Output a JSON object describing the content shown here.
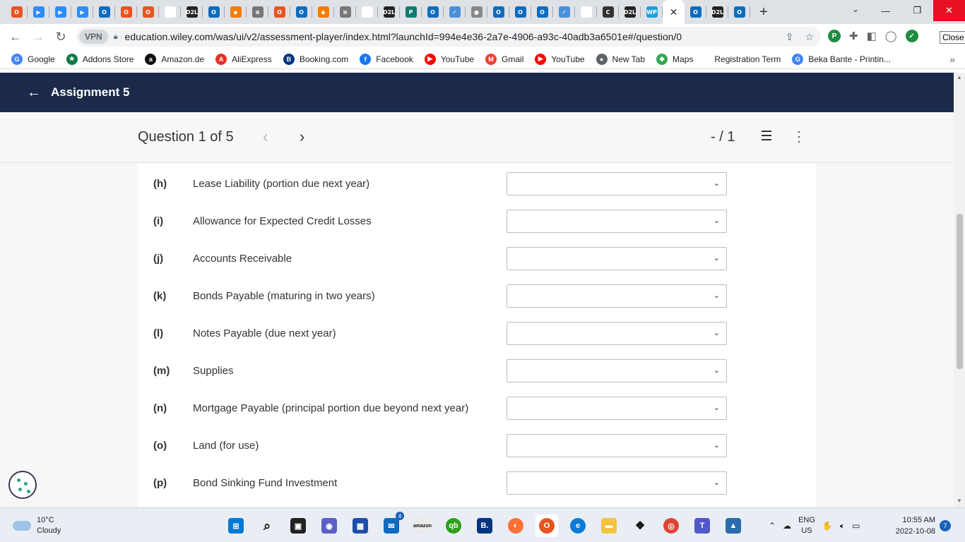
{
  "browser": {
    "tabs": [
      {
        "icon": "ubuntu-icon",
        "color": "#e95420",
        "glyph": "O"
      },
      {
        "icon": "zoom-icon",
        "color": "#2d8cff",
        "glyph": "▶"
      },
      {
        "icon": "zoom-icon",
        "color": "#2d8cff",
        "glyph": "▶"
      },
      {
        "icon": "zoom-icon",
        "color": "#2d8cff",
        "glyph": "▶"
      },
      {
        "icon": "outlook-icon",
        "color": "#0f6cbd",
        "glyph": "O"
      },
      {
        "icon": "ubuntu-icon",
        "color": "#e95420",
        "glyph": "O"
      },
      {
        "icon": "ubuntu-icon",
        "color": "#e95420",
        "glyph": "O"
      },
      {
        "icon": "blank-icon",
        "color": "#ffffff",
        "glyph": ""
      },
      {
        "icon": "d2l-icon",
        "color": "#222222",
        "glyph": "D2L"
      },
      {
        "icon": "outlook-icon",
        "color": "#0f6cbd",
        "glyph": "O"
      },
      {
        "icon": "drop-icon",
        "color": "#f57c00",
        "glyph": "◆"
      },
      {
        "icon": "doc-icon",
        "color": "#777777",
        "glyph": "≡"
      },
      {
        "icon": "ubuntu-icon",
        "color": "#e95420",
        "glyph": "O"
      },
      {
        "icon": "outlook-icon",
        "color": "#0f6cbd",
        "glyph": "O"
      },
      {
        "icon": "drop-icon",
        "color": "#f57c00",
        "glyph": "◆"
      },
      {
        "icon": "doc-icon",
        "color": "#777777",
        "glyph": "≡"
      },
      {
        "icon": "blank-icon",
        "color": "#ffffff",
        "glyph": ""
      },
      {
        "icon": "d2l-icon",
        "color": "#222222",
        "glyph": "D2L"
      },
      {
        "icon": "pearson-icon",
        "color": "#0a7c6e",
        "glyph": "P"
      },
      {
        "icon": "outlook-icon",
        "color": "#0f6cbd",
        "glyph": "O"
      },
      {
        "icon": "check-icon",
        "color": "#4a90d9",
        "glyph": "✓"
      },
      {
        "icon": "globe-icon",
        "color": "#888888",
        "glyph": "●"
      },
      {
        "icon": "outlook-icon",
        "color": "#0f6cbd",
        "glyph": "O"
      },
      {
        "icon": "outlook-icon",
        "color": "#0f6cbd",
        "glyph": "O"
      },
      {
        "icon": "outlook-icon",
        "color": "#0f6cbd",
        "glyph": "O"
      },
      {
        "icon": "check-icon",
        "color": "#4a90d9",
        "glyph": "✓"
      },
      {
        "icon": "blank-icon",
        "color": "#ffffff",
        "glyph": ""
      },
      {
        "icon": "chegg-icon",
        "color": "#333333",
        "glyph": "C"
      },
      {
        "icon": "d2l-icon",
        "color": "#222222",
        "glyph": "D2L"
      },
      {
        "icon": "wp-icon",
        "color": "#1ea0d8",
        "glyph": "WP"
      }
    ],
    "active_tab": {
      "icon": "close-icon",
      "glyph": "✕"
    },
    "tabs_after": [
      {
        "icon": "outlook-icon",
        "color": "#0f6cbd",
        "glyph": "O"
      },
      {
        "icon": "d2l-icon",
        "color": "#222222",
        "glyph": "D2L"
      },
      {
        "icon": "outlook-icon",
        "color": "#0f6cbd",
        "glyph": "O"
      }
    ],
    "new_tab_glyph": "+",
    "url": "education.wiley.com/was/ui/v2/assessment-player/index.html?launchId=994e4e36-2a7e-4906-a93c-40adb3a6501e#/question/0",
    "vpn_label": "VPN",
    "close_tooltip": "Close",
    "bookmarks": [
      {
        "label": "Google",
        "icon": "google-icon",
        "color": "#4285f4",
        "glyph": "G"
      },
      {
        "label": "Addons Store",
        "icon": "addons-icon",
        "color": "#0e7a43",
        "glyph": "★"
      },
      {
        "label": "Amazon.de",
        "icon": "amazon-icon",
        "color": "#111111",
        "glyph": "a"
      },
      {
        "label": "AliExpress",
        "icon": "aliexpress-icon",
        "color": "#e43225",
        "glyph": "A"
      },
      {
        "label": "Booking.com",
        "icon": "booking-icon",
        "color": "#003580",
        "glyph": "B"
      },
      {
        "label": "Facebook",
        "icon": "facebook-icon",
        "color": "#1877f2",
        "glyph": "f"
      },
      {
        "label": "YouTube",
        "icon": "youtube-icon",
        "color": "#ff0000",
        "glyph": "▶"
      },
      {
        "label": "Gmail",
        "icon": "gmail-icon",
        "color": "#ea4335",
        "glyph": "M"
      },
      {
        "label": "YouTube",
        "icon": "youtube-icon",
        "color": "#ff0000",
        "glyph": "▶"
      },
      {
        "label": "New Tab",
        "icon": "globe-icon",
        "color": "#5f6368",
        "glyph": "●"
      },
      {
        "label": "Maps",
        "icon": "maps-icon",
        "color": "#34a853",
        "glyph": "◆"
      },
      {
        "label": "Registration Term",
        "icon": "",
        "color": "#ffffff",
        "glyph": ""
      },
      {
        "label": "Beka Bante - Printin...",
        "icon": "google-icon",
        "color": "#4285f4",
        "glyph": "G"
      }
    ]
  },
  "page": {
    "header_title": "Assignment 5",
    "question_label": "Question 1 of 5",
    "score": "- / 1",
    "rows": [
      {
        "letter": "(h)",
        "text": "Lease Liability (portion due next year)"
      },
      {
        "letter": "(i)",
        "text": "Allowance for Expected Credit Losses"
      },
      {
        "letter": "(j)",
        "text": "Accounts Receivable"
      },
      {
        "letter": "(k)",
        "text": "Bonds Payable (maturing in two years)"
      },
      {
        "letter": "(l)",
        "text": "Notes Payable (due next year)"
      },
      {
        "letter": "(m)",
        "text": "Supplies"
      },
      {
        "letter": "(n)",
        "text": "Mortgage Payable (principal portion due beyond next year)"
      },
      {
        "letter": "(o)",
        "text": "Land (for use)"
      },
      {
        "letter": "(p)",
        "text": "Bond Sinking Fund Investment"
      }
    ]
  },
  "taskbar": {
    "weather_temp": "10°C",
    "weather_desc": "Cloudy",
    "mail_badge": "4",
    "lang_line1": "ENG",
    "lang_line2": "US",
    "time": "10:55 AM",
    "date": "2022-10-08",
    "notifications": "7"
  },
  "colors": {
    "header_bg": "#1b2a4a",
    "close_button": "#e81123",
    "accent": "#1c62b9"
  }
}
